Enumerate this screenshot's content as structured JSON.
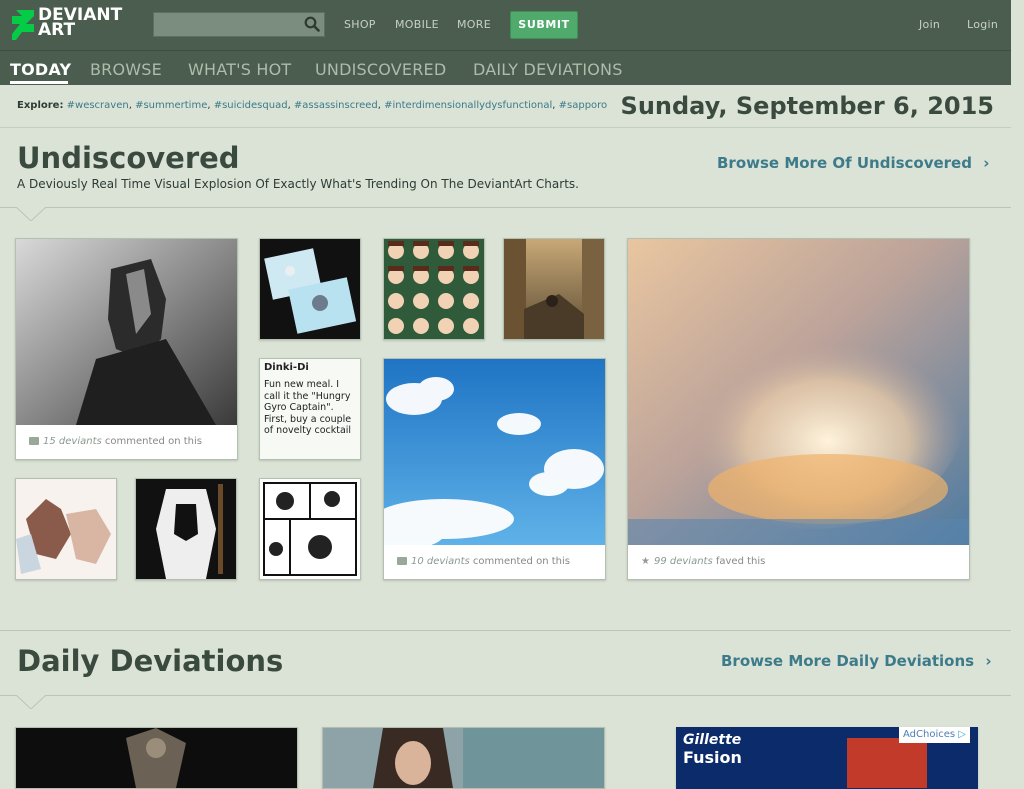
{
  "header": {
    "logo": "DEVIANTART",
    "logo_line1": "DEVIANT",
    "logo_line2": "ART",
    "search": {
      "placeholder": "",
      "value": ""
    },
    "nav": [
      "SHOP",
      "MOBILE",
      "MORE"
    ],
    "submit_label": "SUBMIT",
    "join_label": "Join",
    "login_label": "Login"
  },
  "tabs": [
    {
      "label": "TODAY",
      "active": true
    },
    {
      "label": "BROWSE",
      "active": false
    },
    {
      "label": "WHAT'S HOT",
      "active": false
    },
    {
      "label": "UNDISCOVERED",
      "active": false
    },
    {
      "label": "DAILY DEVIATIONS",
      "active": false
    }
  ],
  "explore": {
    "label": "Explore:",
    "tags": [
      "#wescraven",
      "#summertime",
      "#suicidesquad",
      "#assassinscreed",
      "#interdimensionallydysfunctional",
      "#sapporo"
    ]
  },
  "date": "Sunday, September 6, 2015",
  "undiscovered": {
    "title": "Undiscovered",
    "subtitle": "A Deviously Real Time Visual Explosion Of Exactly What's Trending On The DeviantArt Charts.",
    "browse_more": "Browse More Of Undiscovered",
    "cards": {
      "dark_knight": {
        "count_text": "15 deviants",
        "suffix": " commented on this"
      },
      "lit": {
        "title": "Dinki-Di",
        "body": "Fun new meal. I call it the \"Hungry Gyro Captain\". First, buy a couple of novelty cocktail"
      },
      "sky": {
        "count_text": "10 deviants",
        "suffix": " commented on this"
      },
      "clouds": {
        "count_text": "99 deviants",
        "suffix": " faved this"
      }
    }
  },
  "daily": {
    "title": "Daily Deviations",
    "browse_more": "Browse More Daily Deviations"
  },
  "ad": {
    "choices_label": "AdChoices",
    "brand_line1": "Gillette",
    "brand_line2": "Fusion"
  },
  "colors": {
    "header_bg": "#4a5d4e",
    "page_bg": "#dae3d6",
    "submit_green": "#4faa6c",
    "link_teal": "#3d7a8a",
    "heading_dark": "#3a4a3e"
  }
}
